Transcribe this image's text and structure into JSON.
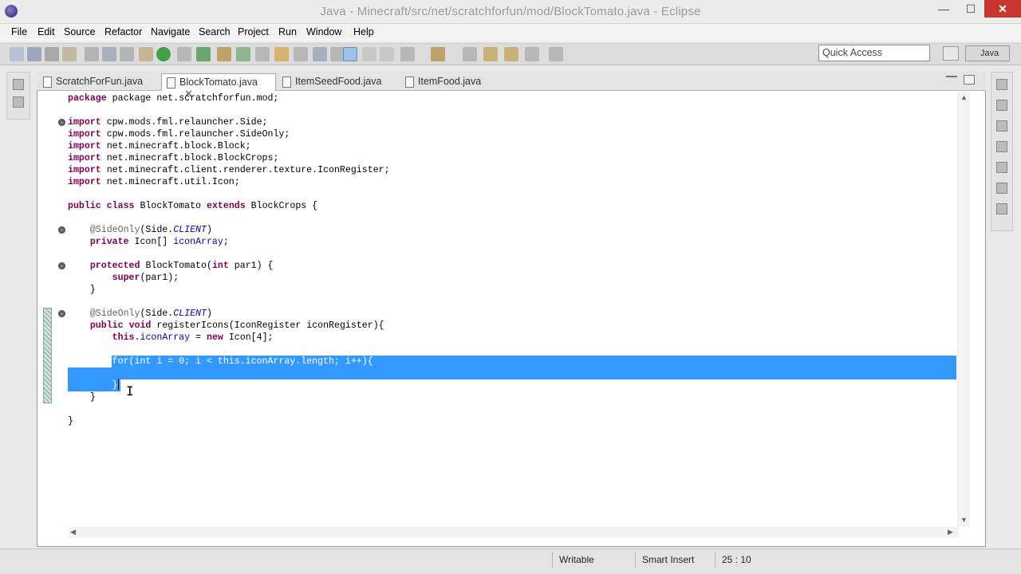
{
  "window": {
    "title": "Java - Minecraft/src/net/scratchforfun/mod/BlockTomato.java - Eclipse",
    "minimize": "—",
    "maximize": "☐",
    "close": "✕"
  },
  "menu": [
    "File",
    "Edit",
    "Source",
    "Refactor",
    "Navigate",
    "Search",
    "Project",
    "Run",
    "Window",
    "Help"
  ],
  "toolbar": {
    "quick_access_placeholder": "Quick Access",
    "perspective_label": "Java"
  },
  "tabs": [
    {
      "label": "ScratchForFun.java"
    },
    {
      "label": "BlockTomato.java",
      "close": "✕"
    },
    {
      "label": "ItemSeedFood.java"
    },
    {
      "label": "ItemFood.java"
    }
  ],
  "code": {
    "line1": "package net.scratchforfun.mod;",
    "imp1": "cpw.mods.fml.relauncher.Side;",
    "imp2": "cpw.mods.fml.relauncher.SideOnly;",
    "imp3": "net.minecraft.block.Block;",
    "imp4": "net.minecraft.block.BlockCrops;",
    "imp5": "net.minecraft.client.renderer.texture.IconRegister;",
    "imp6": "net.minecraft.util.Icon;",
    "class_name": "BlockTomato",
    "super_name": "BlockCrops {",
    "ann1": "@SideOnly",
    "ann_arg": "(Side.",
    "client": "CLIENT",
    "icon_array_type": "Icon[]",
    "icon_array_field": "iconArray",
    "ctor": "BlockTomato(",
    "ctor_param": "par1) {",
    "super_call": "(par1);",
    "method_sig": "registerIcons(IconRegister iconRegister){",
    "assign_field": "iconArray",
    "assign_rest": "Icon[4];",
    "for_loop": "for(int i = 0; i < this.iconArray.length; i++){",
    "close_brace": "}"
  },
  "status": {
    "writable": "Writable",
    "insert_mode": "Smart Insert",
    "position": "25 : 10"
  },
  "colors": {
    "keyword": "#7f0055",
    "field": "#0000c0",
    "selection": "#3399ff",
    "close_button": "#c7372f"
  }
}
